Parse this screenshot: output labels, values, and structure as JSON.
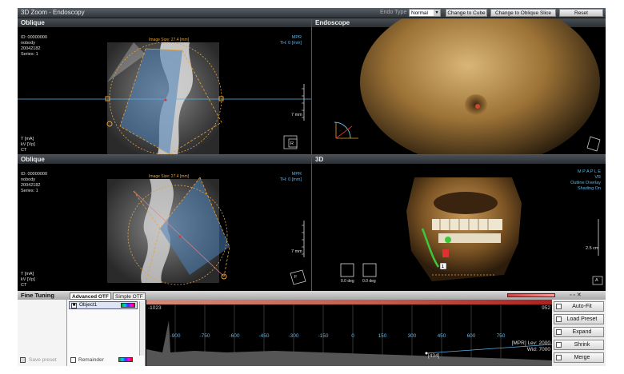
{
  "window": {
    "title": "3D Zoom - Endoscopy",
    "endo_type_label": "Endo Type",
    "endo_type_value": "Normal",
    "change_to_cube": "Change to Cube",
    "change_to_oblique": "Change to Oblique Slice",
    "reset": "Reset"
  },
  "viewports": {
    "top_left": {
      "header": "Oblique",
      "info_lines": [
        "ID: 00000000",
        "nobody",
        "20042182",
        "Series: 1"
      ],
      "info_bottom": [
        "T [mA]",
        "kV [Vp]",
        "CT"
      ],
      "info_right": [
        "MPR",
        "TH: 0 [mm]"
      ],
      "image_size": "Image Size: 27.4    [mm]",
      "scale": "7 mm",
      "orient": "R"
    },
    "top_right": {
      "header": "Endoscope"
    },
    "bottom_left": {
      "header": "Oblique",
      "info_lines": [
        "ID: 00000000",
        "nobody",
        "20042182",
        "Series: 1"
      ],
      "info_bottom": [
        "T [mA]",
        "kV [Vp]",
        "CT"
      ],
      "info_right": [
        "MPR",
        "TH: 0 [mm]"
      ],
      "image_size": "Image Size: 27.4    [mm]",
      "scale": "7 mm",
      "orient": "F"
    },
    "bottom_right": {
      "header": "3D",
      "info_right": [
        "M P A P L E",
        "VR",
        "Outline Overlay",
        "Shading On"
      ],
      "scale": "2.5 cm",
      "orient": "A",
      "icon_labels": [
        "0.0 deg",
        "0.0 deg"
      ],
      "marker": "1"
    }
  },
  "fine_tuning": {
    "title": "Fine Tuning",
    "tabs": [
      "Advanced OTF",
      "Simple OTF"
    ],
    "object": "Object1",
    "remainder": "Remainder",
    "save_preset": "Save preset",
    "otf_min": "-1023",
    "otf_max": "952",
    "axis_ticks": [
      "-900",
      "-750",
      "-600",
      "-450",
      "-300",
      "-150",
      "0",
      "150",
      "300",
      "450",
      "600",
      "750"
    ],
    "mpr_lev": "[MPR] Lev: 2000",
    "wid": "Wid: 7000",
    "point_label": "[434]",
    "buttons": [
      "Auto-Fit",
      "Load Preset",
      "Expand",
      "Shrink",
      "Merge"
    ]
  },
  "colors": {
    "accent_blue": "#5fb4e8",
    "overlay_orange": "#e8a23a",
    "roi_green": "#3cc83c",
    "roi_red": "#e03030"
  }
}
